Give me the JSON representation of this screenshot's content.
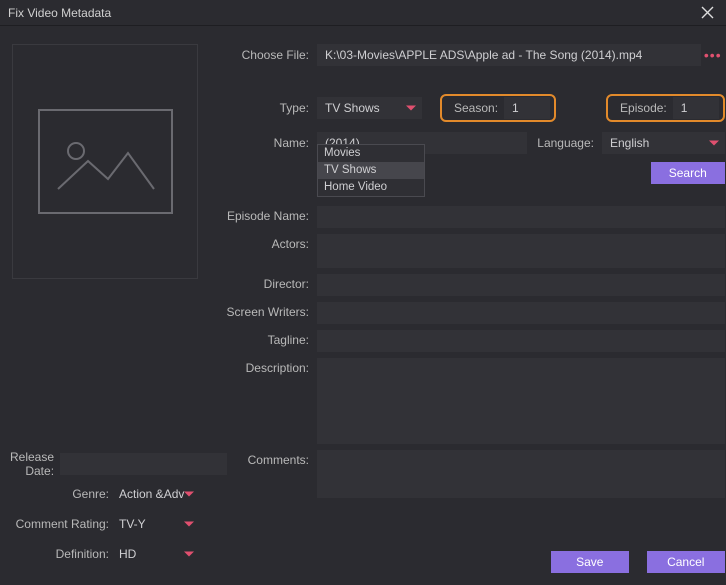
{
  "title": "Fix Video Metadata",
  "choose_file_label": "Choose File:",
  "file_path": "K:\\03-Movies\\APPLE ADS\\Apple ad - The Song (2014).mp4",
  "type_label": "Type:",
  "type_value": "TV Shows",
  "type_options": [
    "Movies",
    "TV Shows",
    "Home Video"
  ],
  "season_label": "Season:",
  "season_value": "1",
  "episode_label": "Episode:",
  "episode_value": "1",
  "name_label": "Name:",
  "name_value": "(2014)",
  "language_label": "Language:",
  "language_value": "English",
  "search_label": "Search",
  "episode_name_label": "Episode Name:",
  "actors_label": "Actors:",
  "director_label": "Director:",
  "screen_writers_label": "Screen Writers:",
  "tagline_label": "Tagline:",
  "description_label": "Description:",
  "comments_label": "Comments:",
  "left": {
    "release_date_label": "Release Date:",
    "release_date_value": "",
    "genre_label": "Genre:",
    "genre_value": "Action &Adv",
    "comment_rating_label": "Comment Rating:",
    "comment_rating_value": "TV-Y",
    "definition_label": "Definition:",
    "definition_value": "HD"
  },
  "save_label": "Save",
  "cancel_label": "Cancel"
}
